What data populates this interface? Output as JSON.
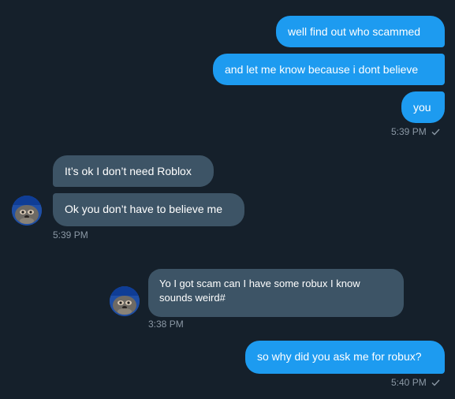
{
  "conversation": {
    "outgoing_top": [
      {
        "text": "well find out who scammed"
      },
      {
        "text": "and let me know because i dont believe"
      },
      {
        "text": "you"
      }
    ],
    "outgoing_top_time": "5:39 PM",
    "incoming": [
      {
        "text": "It’s ok I don’t need Roblox"
      },
      {
        "text": "Ok you don’t have to believe me"
      }
    ],
    "incoming_time": "5:39 PM",
    "quoted_message": {
      "text": "Yo I got scam can I have some robux I know sounds weird#",
      "time": "3:38 PM"
    },
    "outgoing_bottom": {
      "text": "so why did you ask me for robux?"
    },
    "outgoing_bottom_time": "5:40 PM"
  },
  "icons": {
    "read_receipt": "checkmark-icon",
    "avatar": "user-avatar"
  },
  "colors": {
    "background": "#15202b",
    "outgoing_bubble": "#1d9bf0",
    "incoming_bubble": "#3d5466",
    "meta_text": "#8b98a5"
  }
}
